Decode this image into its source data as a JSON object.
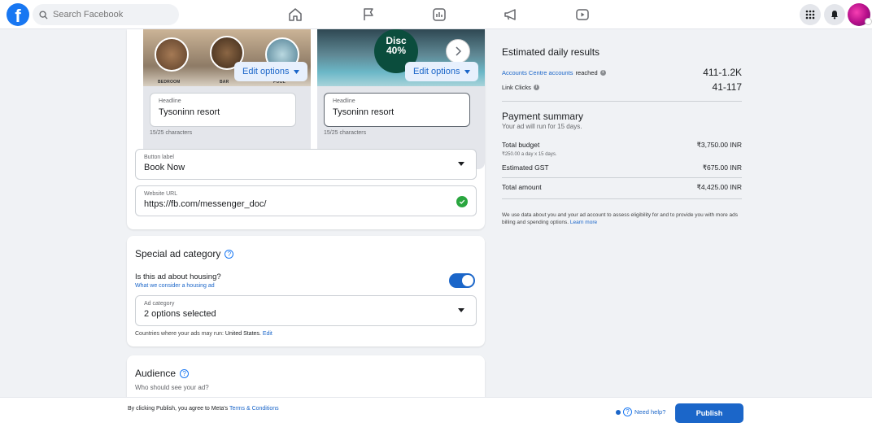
{
  "topbar": {
    "logo_letter": "f",
    "search_placeholder": "Search Facebook"
  },
  "creative": {
    "left": {
      "thumb_labels": [
        "BEDROOM",
        "BAR",
        "POOL"
      ],
      "edit_label": "Edit options",
      "headline_label": "Headline",
      "headline_value": "Tysoninn resort",
      "char_count": "15/25 characters"
    },
    "right": {
      "disc_line1": "Disc",
      "disc_line2": "40%",
      "edit_label": "Edit options",
      "headline_label": "Headline",
      "headline_value": "Tysoninn resort",
      "char_count": "15/25 characters"
    },
    "button_label_field": {
      "label": "Button label",
      "value": "Book Now"
    },
    "website_url_field": {
      "label": "Website URL",
      "value": "https://fb.com/messenger_doc/"
    }
  },
  "special_ad": {
    "title": "Special ad category",
    "question": "Is this ad about housing?",
    "link": "What we consider a housing ad",
    "toggle_on": true,
    "ad_category_label": "Ad category",
    "ad_category_value": "2 options selected",
    "countries_prefix": "Countries where your ads may run:",
    "countries_value": "United States.",
    "countries_edit": "Edit"
  },
  "audience": {
    "title": "Audience",
    "sub": "Who should see your ad?"
  },
  "results": {
    "title": "Estimated daily results",
    "reached_link": "Accounts Centre accounts",
    "reached_suffix": "reached",
    "reached_value": "411-1.2K",
    "clicks_label": "Link Clicks",
    "clicks_value": "41-117"
  },
  "payment": {
    "title": "Payment summary",
    "sub": "Your ad will run for 15 days.",
    "total_budget_label": "Total budget",
    "total_budget_value": "₹3,750.00 INR",
    "budget_detail": "₹250.00 a day x 15 days.",
    "gst_label": "Estimated GST",
    "gst_value": "₹675.00 INR",
    "total_label": "Total amount",
    "total_value": "₹4,425.00 INR",
    "disclaimer": "We use data about you and your ad account to assess eligibility for and to provide you with more ads billing and spending options.",
    "learn_more": "Learn more"
  },
  "bottom": {
    "terms_prefix": "By clicking Publish, you agree to Meta's",
    "terms_link": "Terms & Conditions",
    "help": "Need help?",
    "publish": "Publish"
  },
  "colors": {
    "brand": "#1877f2",
    "link": "#1b66c9",
    "success": "#2aa63f"
  }
}
